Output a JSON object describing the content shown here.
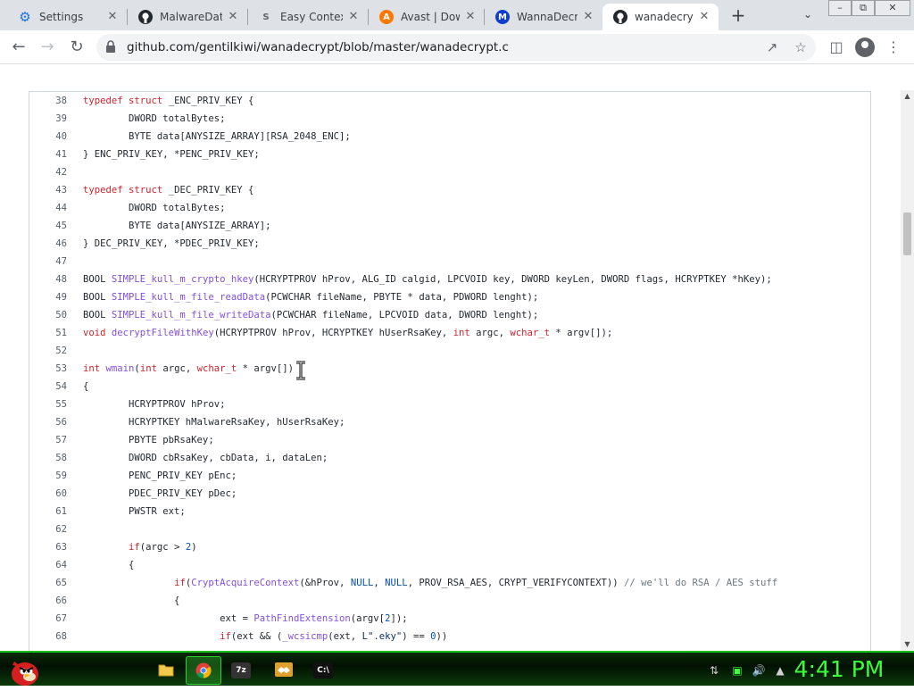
{
  "browser": {
    "tabs": [
      {
        "title": "Settings",
        "icon": "settings-gear-icon",
        "icon_color": "#1a73e8",
        "active": false
      },
      {
        "title": "MalwareData",
        "icon": "github-icon",
        "icon_color": "#24292f",
        "active": false
      },
      {
        "title": "Easy Context",
        "icon": "s-logo-icon",
        "icon_color": "#5f6368",
        "active": false
      },
      {
        "title": "Avast | Down",
        "icon": "avast-icon",
        "icon_color": "#ff7800",
        "active": false
      },
      {
        "title": "WannaDecry",
        "icon": "malwarebytes-icon",
        "icon_color": "#0d3ecc",
        "active": false
      },
      {
        "title": "wanadecrypt",
        "icon": "github-icon",
        "icon_color": "#24292f",
        "active": true
      }
    ],
    "new_tab_label": "+",
    "url": "github.com/gentilkiwi/wanadecrypt/blob/master/wanadecrypt.c"
  },
  "code": {
    "lines": [
      {
        "n": "38",
        "text": "typedef struct _ENC_PRIV_KEY {"
      },
      {
        "n": "39",
        "text": "        DWORD totalBytes;"
      },
      {
        "n": "40",
        "text": "        BYTE data[ANYSIZE_ARRAY][RSA_2048_ENC];"
      },
      {
        "n": "41",
        "text": "} ENC_PRIV_KEY, *PENC_PRIV_KEY;"
      },
      {
        "n": "42",
        "text": ""
      },
      {
        "n": "43",
        "text": "typedef struct _DEC_PRIV_KEY {"
      },
      {
        "n": "44",
        "text": "        DWORD totalBytes;"
      },
      {
        "n": "45",
        "text": "        BYTE data[ANYSIZE_ARRAY];"
      },
      {
        "n": "46",
        "text": "} DEC_PRIV_KEY, *PDEC_PRIV_KEY;"
      },
      {
        "n": "47",
        "text": ""
      },
      {
        "n": "48",
        "text": "BOOL SIMPLE_kull_m_crypto_hkey(HCRYPTPROV hProv, ALG_ID calgid, LPCVOID key, DWORD keyLen, DWORD flags, HCRYPTKEY *hKey);"
      },
      {
        "n": "49",
        "text": "BOOL SIMPLE_kull_m_file_readData(PCWCHAR fileName, PBYTE * data, PDWORD lenght);"
      },
      {
        "n": "50",
        "text": "BOOL SIMPLE_kull_m_file_writeData(PCWCHAR fileName, LPCVOID data, DWORD lenght);"
      },
      {
        "n": "51",
        "text": "void decryptFileWithKey(HCRYPTPROV hProv, HCRYPTKEY hUserRsaKey, int argc, wchar_t * argv[]);"
      },
      {
        "n": "52",
        "text": ""
      },
      {
        "n": "53",
        "text": "int wmain(int argc, wchar_t * argv[])"
      },
      {
        "n": "54",
        "text": "{"
      },
      {
        "n": "55",
        "text": "        HCRYPTPROV hProv;"
      },
      {
        "n": "56",
        "text": "        HCRYPTKEY hMalwareRsaKey, hUserRsaKey;"
      },
      {
        "n": "57",
        "text": "        PBYTE pbRsaKey;"
      },
      {
        "n": "58",
        "text": "        DWORD cbRsaKey, cbData, i, dataLen;"
      },
      {
        "n": "59",
        "text": "        PENC_PRIV_KEY pEnc;"
      },
      {
        "n": "60",
        "text": "        PDEC_PRIV_KEY pDec;"
      },
      {
        "n": "61",
        "text": "        PWSTR ext;"
      },
      {
        "n": "62",
        "text": ""
      },
      {
        "n": "63",
        "text": "        if(argc > 2)"
      },
      {
        "n": "64",
        "text": "        {"
      },
      {
        "n": "65",
        "text": "                if(CryptAcquireContext(&hProv, NULL, NULL, PROV_RSA_AES, CRYPT_VERIFYCONTEXT)) // we'll do RSA / AES stuff"
      },
      {
        "n": "66",
        "text": "                {"
      },
      {
        "n": "67",
        "text": "                        ext = PathFindExtension(argv[2]);"
      },
      {
        "n": "68",
        "text": "                        if(ext && (_wcsicmp(ext, L\".eky\") == 0))"
      }
    ]
  },
  "taskbar": {
    "items": [
      {
        "icon": "file-explorer-icon",
        "active": false
      },
      {
        "icon": "chrome-icon",
        "active": true
      },
      {
        "icon": "7zip-icon",
        "label": "7z",
        "active": false
      },
      {
        "icon": "handshake-icon",
        "active": false
      },
      {
        "icon": "command-prompt-icon",
        "label": "C:\\",
        "active": false
      }
    ],
    "clock": "4:41 PM"
  }
}
